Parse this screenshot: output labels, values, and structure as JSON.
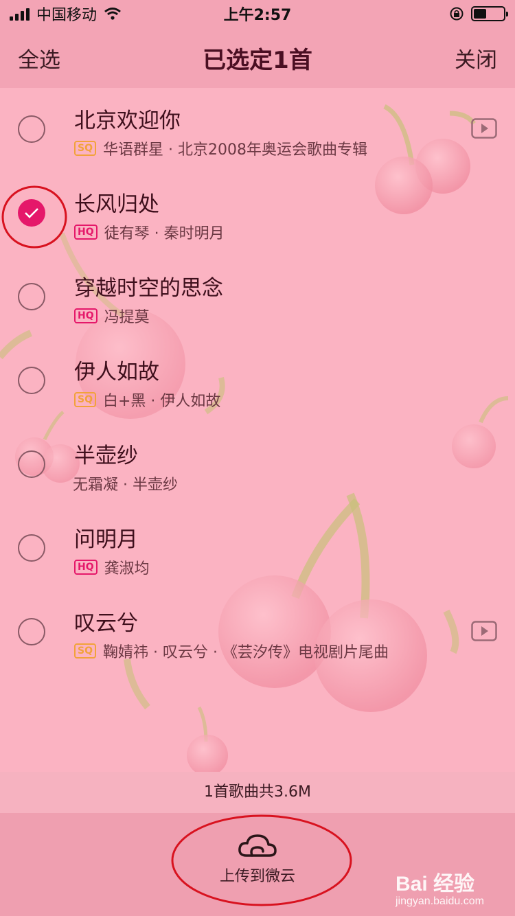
{
  "status_bar": {
    "carrier": "中国移动",
    "time": "上午2:57"
  },
  "nav": {
    "select_all": "全选",
    "title": "已选定1首",
    "close": "关闭"
  },
  "songs": [
    {
      "title": "北京欢迎你",
      "quality": "SQ",
      "meta": "华语群星 · 北京2008年奥运会歌曲专辑",
      "selected": false,
      "has_mv": true
    },
    {
      "title": "长风归处",
      "quality": "HQ",
      "meta": "徒有琴 · 秦时明月",
      "selected": true,
      "has_mv": false
    },
    {
      "title": "穿越时空的思念",
      "quality": "HQ",
      "meta": "冯提莫",
      "selected": false,
      "has_mv": false
    },
    {
      "title": "伊人如故",
      "quality": "SQ",
      "meta": "白+黑 · 伊人如故",
      "selected": false,
      "has_mv": false
    },
    {
      "title": "半壶纱",
      "quality": "",
      "meta": "无霜凝 · 半壶纱",
      "selected": false,
      "has_mv": false
    },
    {
      "title": "问明月",
      "quality": "HQ",
      "meta": "龚淑均",
      "selected": false,
      "has_mv": false
    },
    {
      "title": "叹云兮",
      "quality": "SQ",
      "meta": "鞠婧祎 · 叹云兮 · 《芸汐传》电视剧片尾曲",
      "selected": false,
      "has_mv": true
    }
  ],
  "footer": {
    "size_text": "1首歌曲共3.6M",
    "upload_label": "上传到微云"
  },
  "icons": {
    "upload": "cloud-icon",
    "play": "play-icon",
    "check": "checkmark-icon"
  },
  "colors": {
    "accent": "#e5186a",
    "sq_badge": "#f2a23a",
    "background": "#fbb3c2"
  },
  "watermark": {
    "main": "Bai 经验",
    "sub": "jingyan.baidu.com"
  }
}
